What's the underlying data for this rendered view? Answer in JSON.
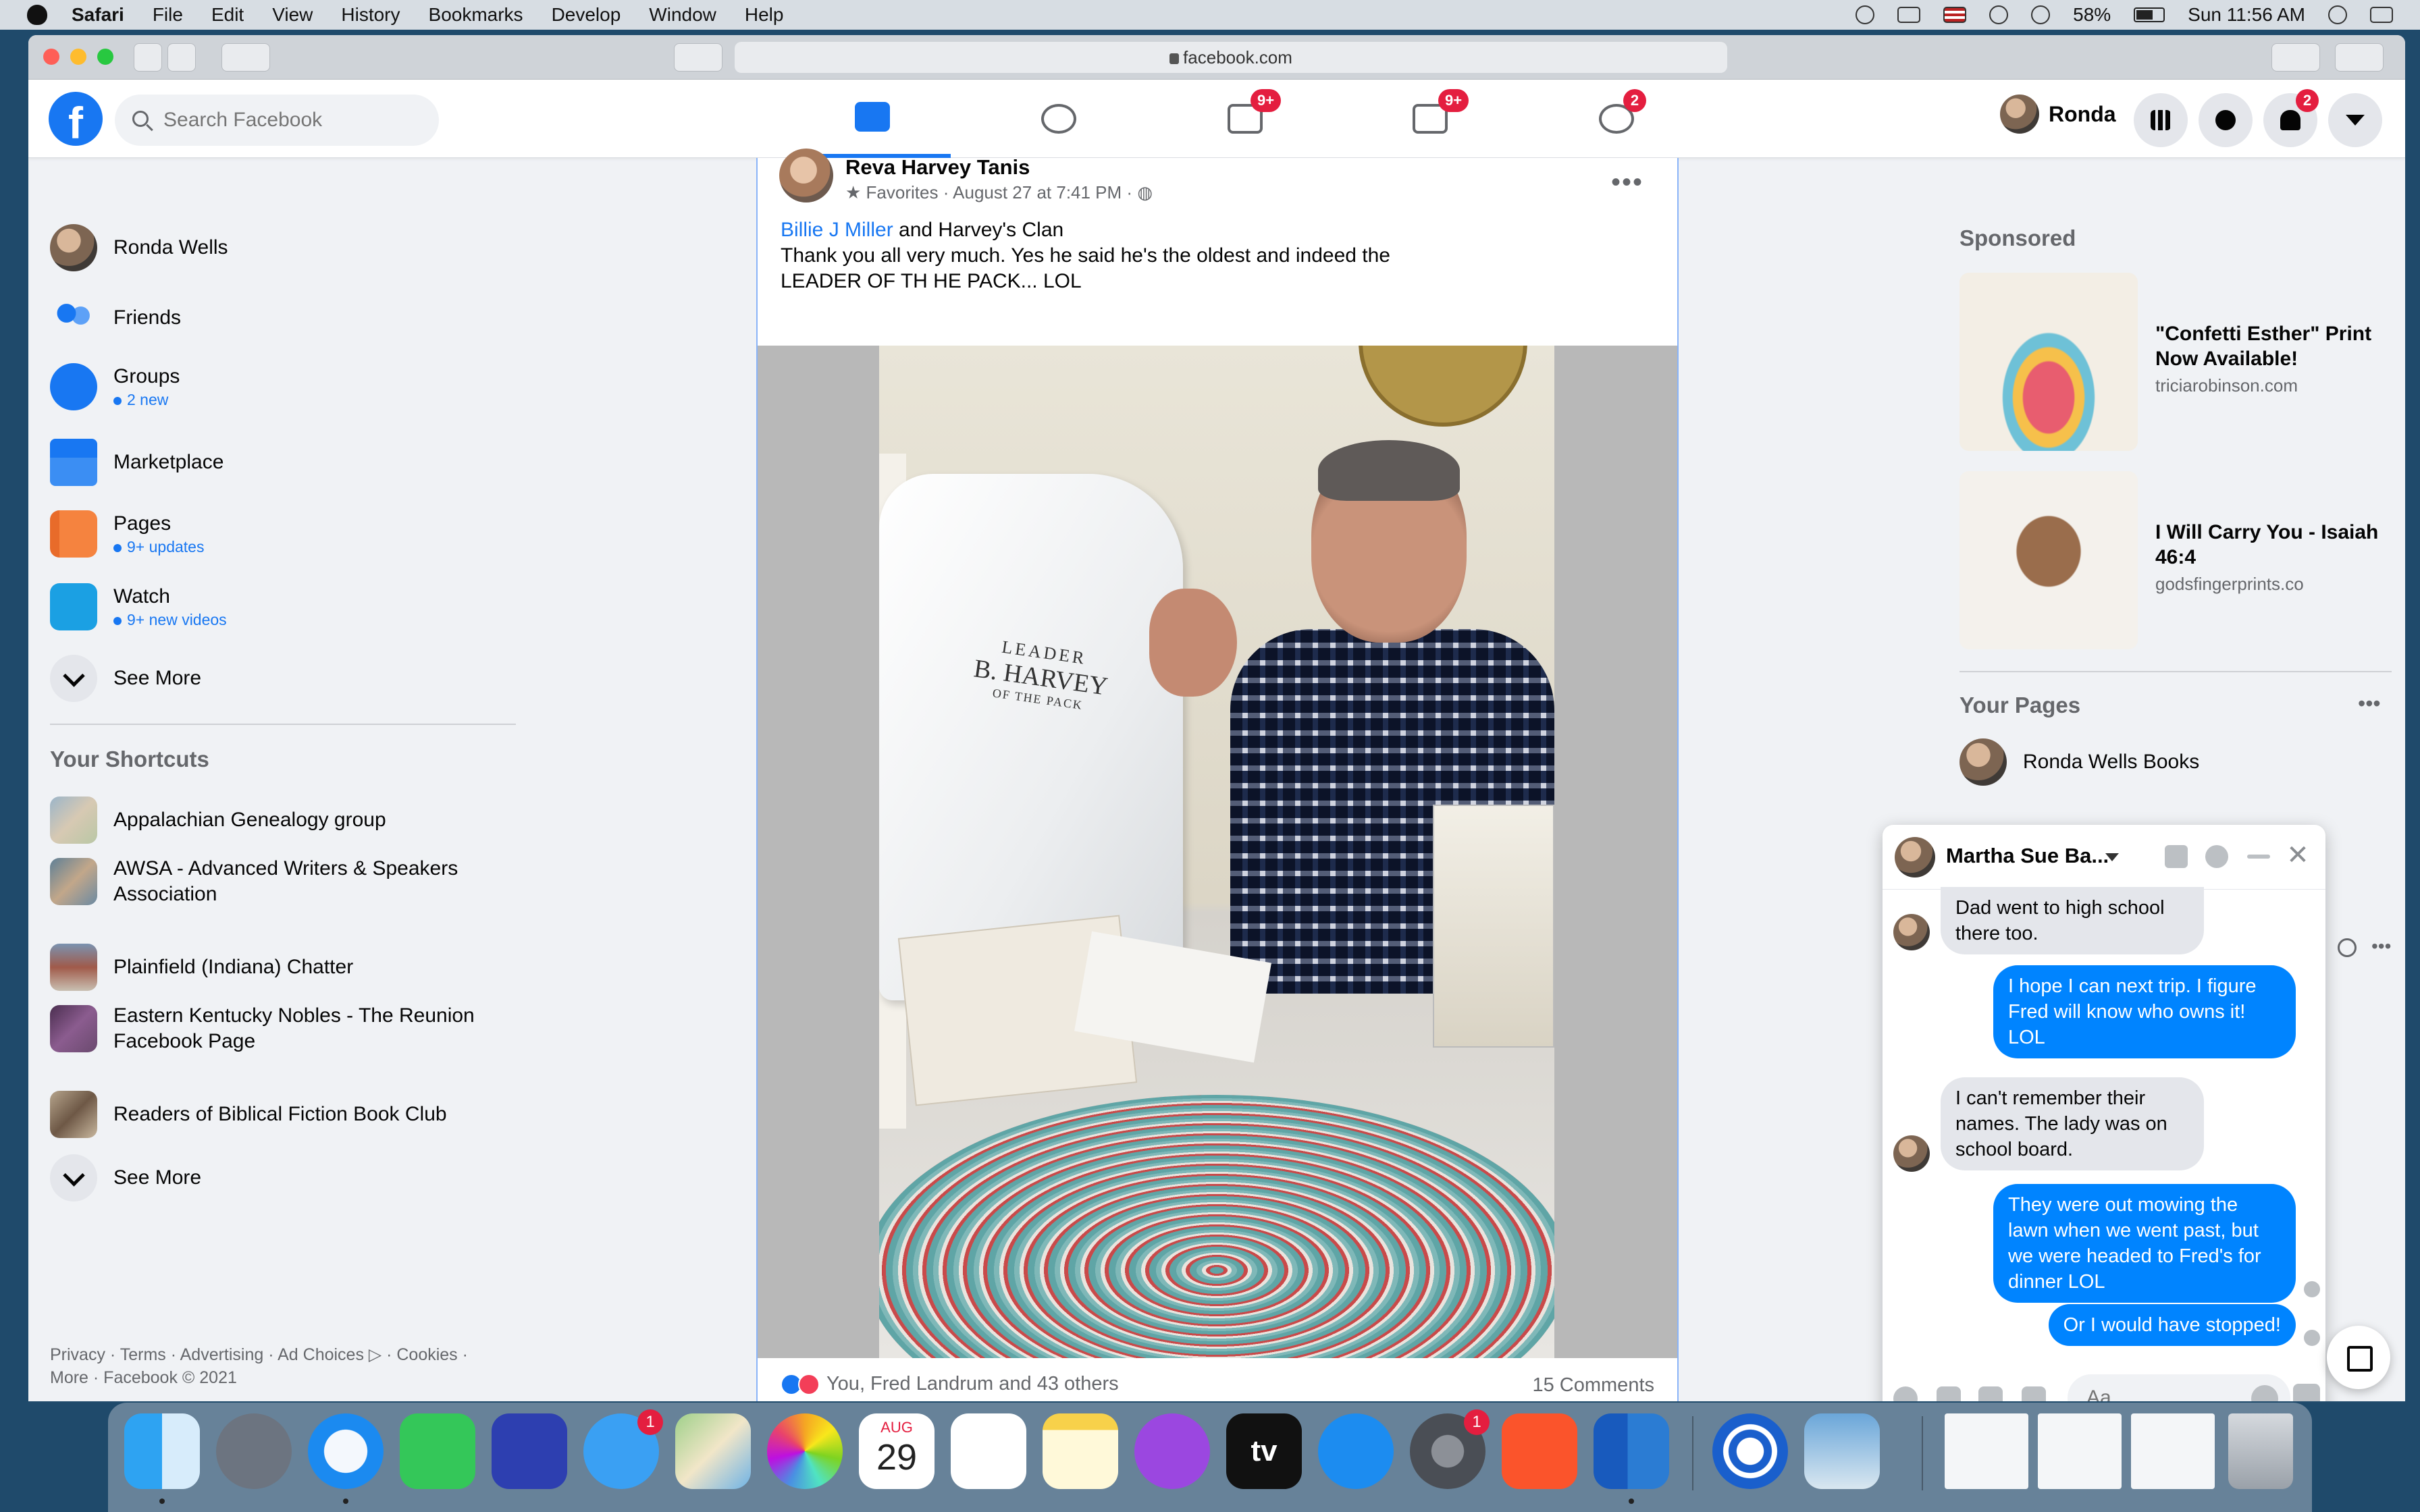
{
  "menubar": {
    "items": [
      "Safari",
      "File",
      "Edit",
      "View",
      "History",
      "Bookmarks",
      "Develop",
      "Window",
      "Help"
    ],
    "battery": "58%",
    "clock": "Sun 11:56 AM"
  },
  "browser": {
    "url": "facebook.com",
    "icons": [
      "back-icon",
      "forward-icon",
      "sidebar-icon",
      "shield-icon",
      "reload-icon",
      "share-icon",
      "tabs-icon",
      "new-tab-icon"
    ]
  },
  "fb_nav": {
    "logo": "f",
    "search_placeholder": "Search Facebook",
    "tabs": [
      {
        "name": "home",
        "badge": ""
      },
      {
        "name": "friends",
        "badge": ""
      },
      {
        "name": "pages",
        "badge": "9+"
      },
      {
        "name": "watch",
        "badge": "9+"
      },
      {
        "name": "groups",
        "badge": "2"
      }
    ],
    "user": "Ronda",
    "notif_badge": "2"
  },
  "sidebar": {
    "items": [
      {
        "label": "Ronda Wells",
        "sub": ""
      },
      {
        "label": "Friends",
        "sub": ""
      },
      {
        "label": "Groups",
        "sub": "2 new"
      },
      {
        "label": "Marketplace",
        "sub": ""
      },
      {
        "label": "Pages",
        "sub": "9+ updates"
      },
      {
        "label": "Watch",
        "sub": "9+ new videos"
      }
    ],
    "see_more": "See More",
    "shortcuts_title": "Your Shortcuts",
    "shortcuts": [
      "Appalachian Genealogy group",
      "AWSA - Advanced Writers & Speakers Association",
      "Plainfield (Indiana) Chatter",
      "Eastern Kentucky Nobles - The Reunion Facebook Page",
      "Readers of Biblical Fiction Book Club"
    ],
    "see_more_2": "See More",
    "footer": "Privacy · Terms · Advertising · Ad Choices ▷ · Cookies · More · Facebook © 2021"
  },
  "post": {
    "author": "Reva Harvey Tanis",
    "meta": "Favorites · August 27 at 7:41 PM ·",
    "dots": "•••",
    "tag_name": "Billie J Miller",
    "text_after_tag": " and Harvey's  Clan",
    "line2": "Thank you all very much. Yes he said he's the oldest and indeed the",
    "line3": "LEADER OF TH HE PACK...  LOL",
    "shirt_text_top": "LEADER",
    "shirt_text_main": "B. HARVEY",
    "shirt_text_bottom": "OF THE PACK",
    "reactions": "You, Fred Landrum and 43 others",
    "comments": "15 Comments"
  },
  "right": {
    "sponsored_title": "Sponsored",
    "ads": [
      {
        "title": "\"Confetti Esther\" Print Now Available!",
        "domain": "triciarobinson.com"
      },
      {
        "title": "I Will Carry You - Isaiah 46:4",
        "domain": "godsfingerprints.co"
      }
    ],
    "pages_title": "Your Pages",
    "pages_dots": "•••",
    "page_name": "Ronda Wells Books"
  },
  "chat": {
    "name": "Martha Sue Ba...",
    "messages": [
      {
        "dir": "in",
        "text": "Dad went to high school there too."
      },
      {
        "dir": "out",
        "text": "I hope I can next trip. I figure Fred will know who owns it! LOL"
      },
      {
        "dir": "in",
        "text": "I can't remember their names. The lady was on school board."
      },
      {
        "dir": "out",
        "text": "They were out mowing the lawn when we went past, but we were headed to Fred's for dinner LOL"
      },
      {
        "dir": "out",
        "text": "Or I would have stopped!"
      }
    ],
    "input_placeholder": "Aa"
  },
  "dock": {
    "apps": [
      "finder-icon",
      "launchpad-icon",
      "safari-icon",
      "facetime-icon",
      "scanner-icon",
      "messages-icon",
      "maps-icon",
      "photos-icon",
      "calendar-icon",
      "reminders-icon",
      "notes-icon",
      "podcasts-icon",
      "tv-icon",
      "appstore-icon",
      "settings-icon",
      "brave-icon",
      "word-icon",
      "app-icon",
      "preview-icon"
    ],
    "messages_badge": "1",
    "settings_badge": "1",
    "calendar_month": "AUG",
    "calendar_day": "29",
    "tv_label": "tv"
  },
  "colors": {
    "fb_blue": "#1877f2",
    "badge_red": "#e41e3f",
    "messenger_blue": "#0084ff"
  }
}
